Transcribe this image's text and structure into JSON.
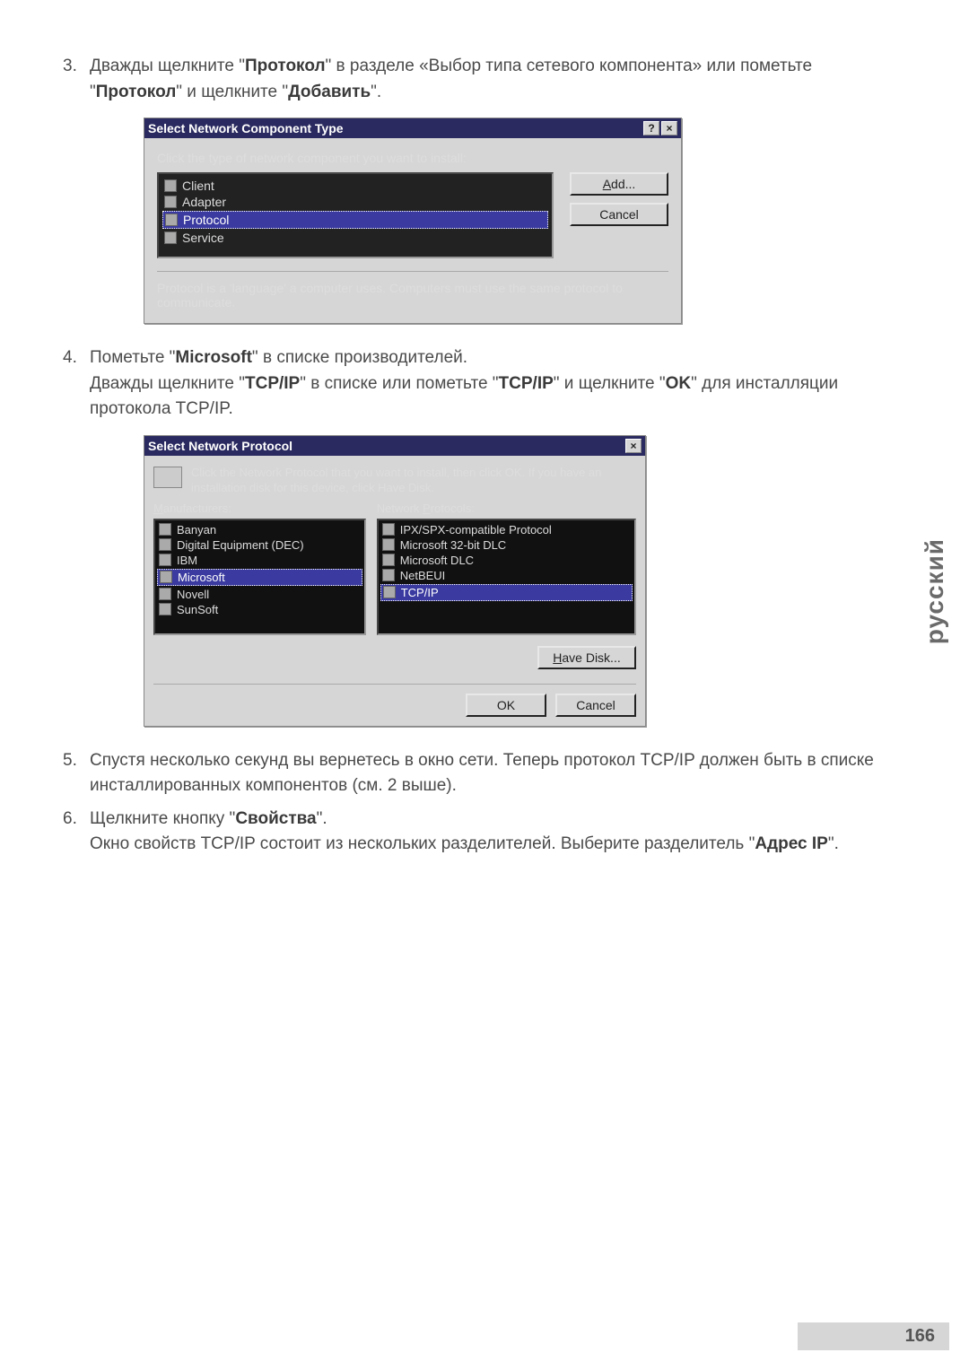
{
  "steps": {
    "s3": {
      "num": "3.",
      "text_a": "Дважды щелкните \"",
      "b1": "Протокол",
      "text_b": "\" в разделе «Выбор типа сетевого компонента» или пометьте \"",
      "b2": "Протокол",
      "text_c": "\" и щелкните \"",
      "b3": "Добавить",
      "text_d": "\"."
    },
    "s4": {
      "num": "4.",
      "line1_a": "Пометьте \"",
      "line1_b": "Microsoft",
      "line1_c": "\" в списке производителей.",
      "line2_a": "Дважды щелкните \"",
      "line2_b": "TCP/IP",
      "line2_c": "\" в списке или пометьте \"",
      "line2_d": "TCP/IP",
      "line2_e": "\" и щелкните \"",
      "line2_f": "OK",
      "line2_g": "\" для инсталляции протокола TCP/IP."
    },
    "s5": {
      "num": "5.",
      "text": "Спустя несколько секунд вы вернетесь в окно сети. Теперь протокол TCP/IP должен быть в списке инсталлированных компонентов (см. 2 выше)."
    },
    "s6": {
      "num": "6.",
      "line1_a": "Щелкните кнопку \"",
      "line1_b": "Свойства",
      "line1_c": "\".",
      "line2_a": "Окно свойств TCP/IP состоит из нескольких разделителей. Выберите разделитель \"",
      "line2_b": "Адрес IP",
      "line2_c": "\"."
    }
  },
  "dialog1": {
    "title": "Select Network Component Type",
    "help": "?",
    "close": "×",
    "prompt": "Click the type of network component you want to install:",
    "items": [
      "Client",
      "Adapter",
      "Protocol",
      "Service"
    ],
    "selected": 2,
    "add": "Add...",
    "cancel": "Cancel",
    "desc": "Protocol is a 'language' a computer uses. Computers must use the same protocol to communicate."
  },
  "dialog2": {
    "title": "Select Network Protocol",
    "close": "×",
    "top": "Click the Network Protocol that you want to install, then click OK. If you have an installation disk for this device, click Have Disk.",
    "label_m": "Manufacturers:",
    "label_m_u": "M",
    "label_p": "Network Protocols:",
    "label_p_u": "P",
    "manufacturers": [
      "Banyan",
      "Digital Equipment (DEC)",
      "IBM",
      "Microsoft",
      "Novell",
      "SunSoft"
    ],
    "man_selected": 3,
    "protocols": [
      "IPX/SPX-compatible Protocol",
      "Microsoft 32-bit DLC",
      "Microsoft DLC",
      "NetBEUI",
      "TCP/IP"
    ],
    "prot_selected": 4,
    "havedisk": "Have Disk...",
    "havedisk_u": "H",
    "ok": "OK",
    "cancel": "Cancel"
  },
  "side": "русский",
  "pagenum": "166"
}
